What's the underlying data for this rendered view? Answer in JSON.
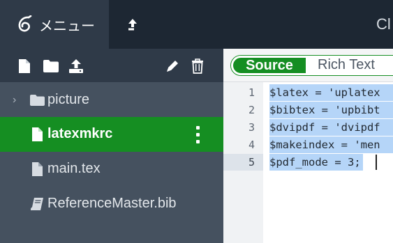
{
  "topbar": {
    "menu_label": "メニュー",
    "title_partial": "Cl",
    "icons": {
      "logo": "overleaf-leaf-icon",
      "upload": "arrow-upload-icon"
    }
  },
  "sidebar": {
    "toolbar": {
      "icons": [
        "new-file-icon",
        "new-folder-icon",
        "upload-icon",
        "pencil-icon",
        "trash-icon"
      ]
    },
    "tree": [
      {
        "label": "picture",
        "type": "folder",
        "icon": "folder-icon",
        "collapsed": true
      },
      {
        "label": "latexmkrc",
        "type": "file",
        "icon": "file-icon",
        "active": true
      },
      {
        "label": "main.tex",
        "type": "file",
        "icon": "file-icon"
      },
      {
        "label": "ReferenceMaster.bib",
        "type": "bib",
        "icon": "book-icon"
      }
    ]
  },
  "editor": {
    "mode_source": "Source",
    "mode_rich": "Rich Text",
    "line_numbers": [
      "1",
      "2",
      "3",
      "4",
      "5"
    ],
    "lines": [
      "$latex = 'uplatex",
      "$bibtex = 'upbibt",
      "$dvipdf = 'dvipdf",
      "$makeindex = 'men",
      "$pdf_mode = 3;"
    ]
  },
  "colors": {
    "accent_green": "#158e22",
    "topbar_bg": "#1d2733",
    "sidebar_bg": "#2f3a48",
    "tree_bg": "#45515f",
    "selection": "#b5d5f8"
  }
}
